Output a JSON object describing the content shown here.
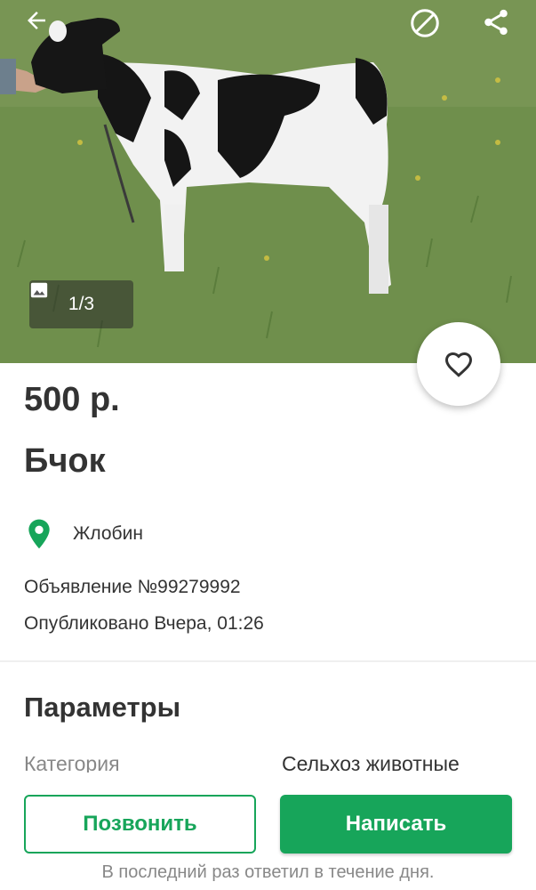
{
  "photo": {
    "counter": "1/3",
    "image_icon": "image-icon",
    "back_icon": "arrow-left-icon",
    "block_icon": "block-icon",
    "share_icon": "share-icon"
  },
  "favorite_icon": "heart-outline-icon",
  "listing": {
    "price": "500 р.",
    "title": "Бчок",
    "location_icon": "map-pin-icon",
    "location": "Жлобин",
    "ad_number": "Объявление №99279992",
    "published": "Опубликовано Вчера, 01:26"
  },
  "params": {
    "title": "Параметры",
    "rows": [
      {
        "key": "Категория",
        "value": "Сельхоз животные"
      }
    ]
  },
  "actions": {
    "call_label": "Позвонить",
    "write_label": "Написать",
    "reply_note": "В последний раз ответил в течение дня."
  },
  "colors": {
    "accent": "#17a55a",
    "text": "#333333",
    "muted": "#888888"
  }
}
